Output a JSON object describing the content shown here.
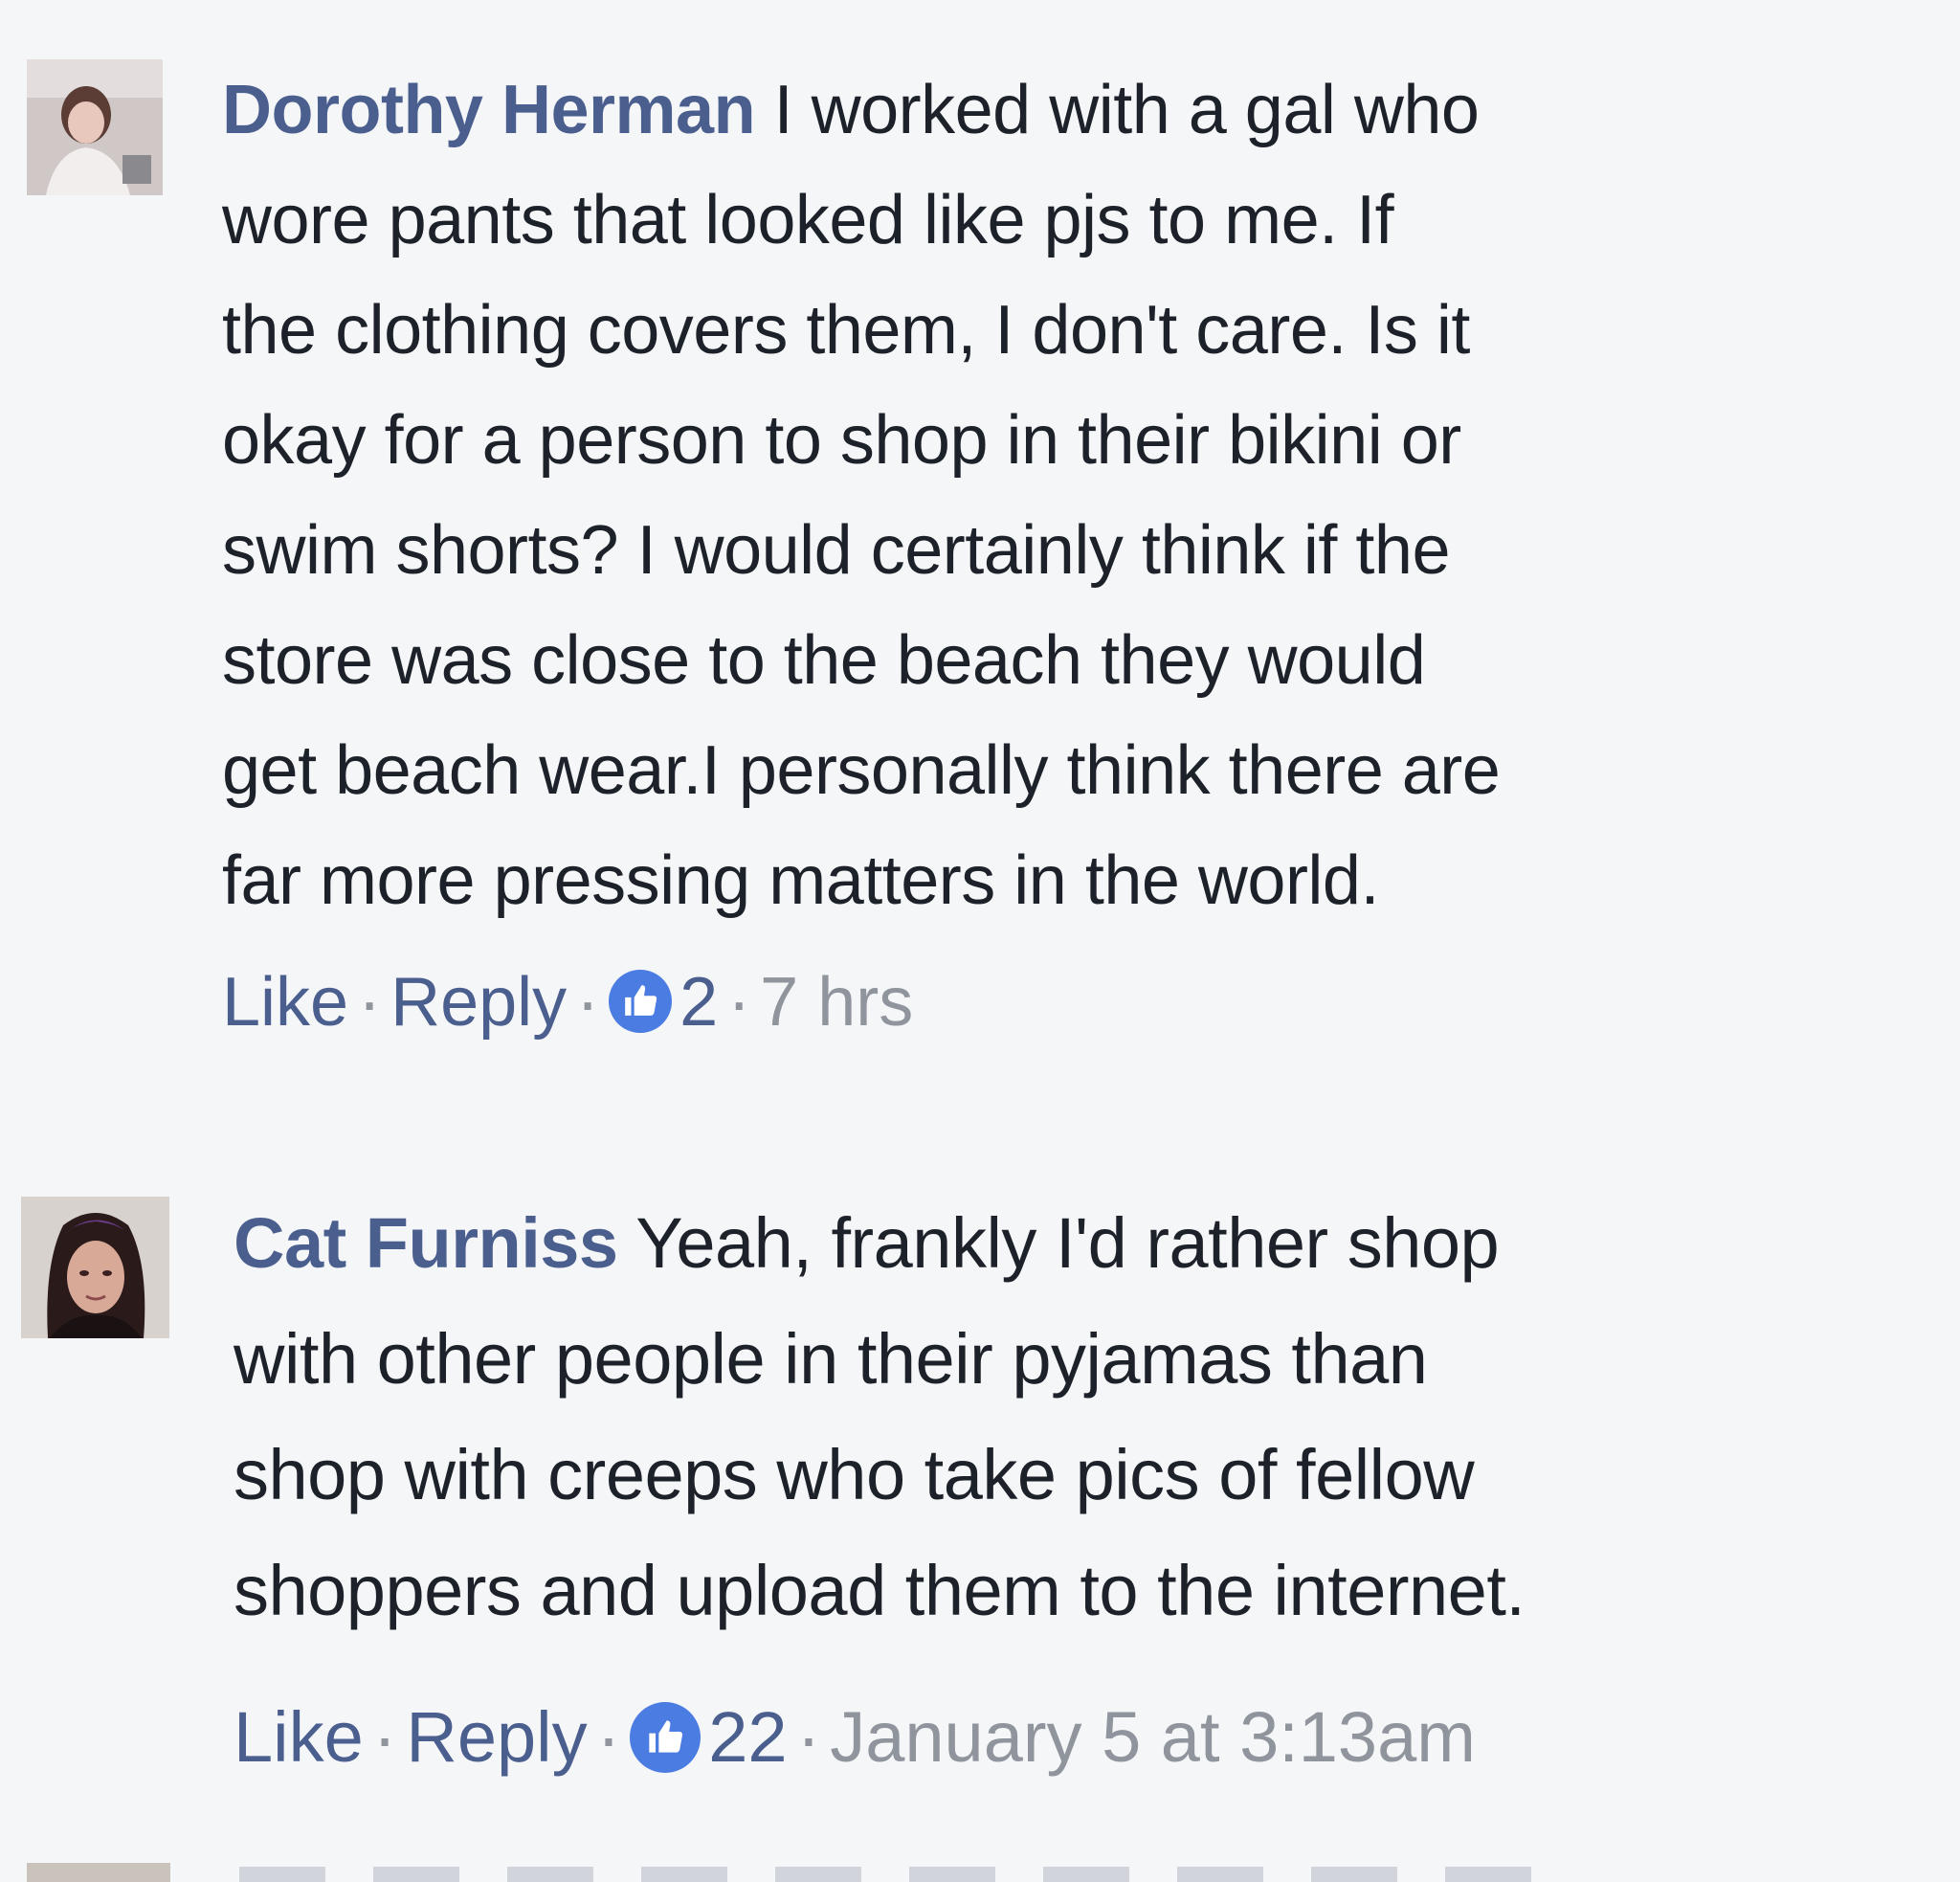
{
  "comments": [
    {
      "author": "Dorothy Herman",
      "lines": [
        " I worked with a gal who",
        "wore pants that looked like pjs to me. If",
        "the clothing covers them, I don't care. Is it",
        "okay for a person to shop in their bikini or",
        "swim shorts? I would certainly think if the",
        "store was close to the beach they would",
        "get beach wear.I personally think there are",
        "far more pressing matters in the world."
      ],
      "like_label": "Like",
      "reply_label": "Reply",
      "separator": "·",
      "reaction_count": "2",
      "timestamp": "7 hrs",
      "reaction_icon": "thumbs-up-icon"
    },
    {
      "author": "Cat Furniss",
      "lines": [
        " Yeah, frankly I'd rather shop",
        "with other people in their pyjamas than",
        "shop with creeps who take pics of fellow",
        "shoppers and upload them to the internet."
      ],
      "like_label": "Like",
      "reply_label": "Reply",
      "separator": "·",
      "reaction_count": "22",
      "timestamp": "January 5 at 3:13am",
      "reaction_icon": "thumbs-up-icon"
    }
  ],
  "colors": {
    "background": "#f5f6f8",
    "author_link": "#4b5f8f",
    "text": "#1d2129",
    "meta": "#90949c",
    "like_badge": "#4a7ce2"
  }
}
